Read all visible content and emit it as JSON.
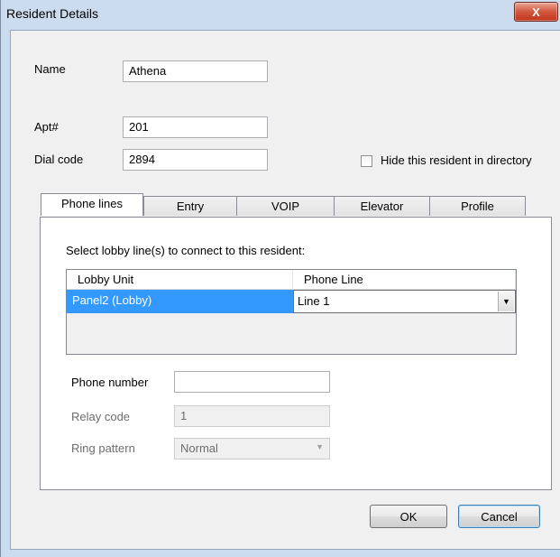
{
  "window": {
    "title": "Resident Details",
    "close_label": "X"
  },
  "form": {
    "name_label": "Name",
    "name_value": "Athena",
    "apt_label": "Apt#",
    "apt_value": "201",
    "dialcode_label": "Dial code",
    "dialcode_value": "2894",
    "hide_label": "Hide this resident in directory",
    "hide_checked": false
  },
  "tabs": [
    {
      "label": "Phone lines",
      "active": true
    },
    {
      "label": "Entry",
      "active": false
    },
    {
      "label": "VOIP",
      "active": false
    },
    {
      "label": "Elevator",
      "active": false
    },
    {
      "label": "Profile",
      "active": false
    }
  ],
  "phone_lines": {
    "instruction": "Select lobby line(s) to connect to this resident:",
    "columns": [
      "Lobby Unit",
      "Phone Line"
    ],
    "rows": [
      {
        "lobby_unit": "Panel2 (Lobby)",
        "phone_line": "Line 1"
      }
    ],
    "phone_number_label": "Phone number",
    "phone_number_value": "",
    "relay_code_label": "Relay code",
    "relay_code_value": "1",
    "ring_pattern_label": "Ring pattern",
    "ring_pattern_value": "Normal"
  },
  "buttons": {
    "ok": "OK",
    "cancel": "Cancel"
  }
}
